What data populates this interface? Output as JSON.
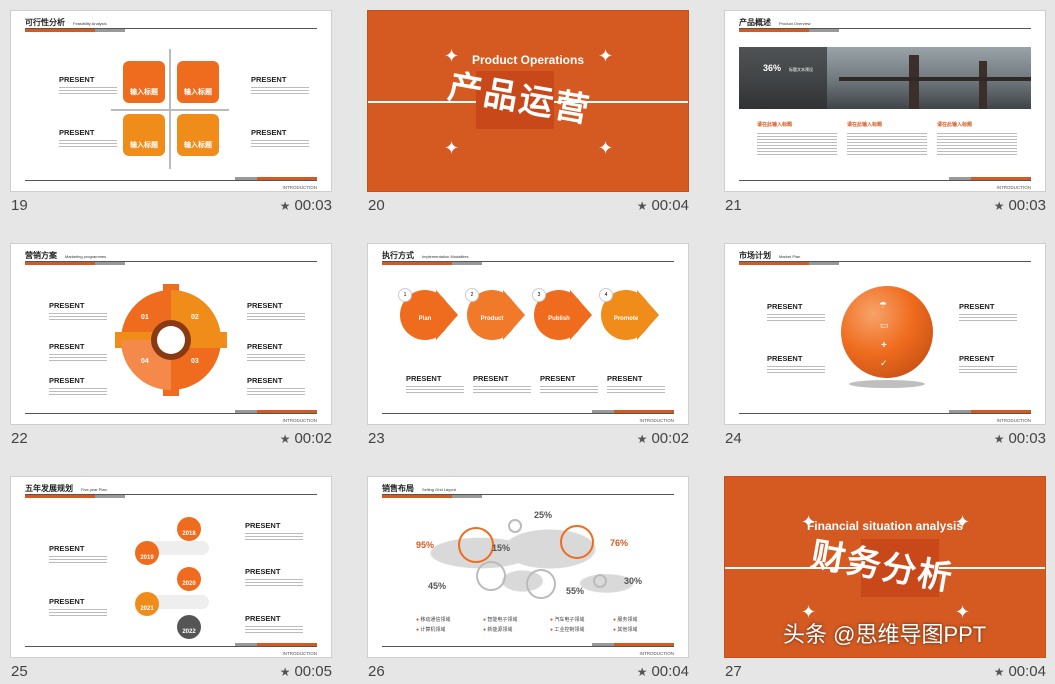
{
  "watermark": "头条 @思维导图PPT",
  "colors": {
    "accent": "#d45a22",
    "orange": "#ef6c1e",
    "gray": "#999999",
    "background": "#e6e6e6"
  },
  "slides": [
    {
      "num": "19",
      "duration": "00:03",
      "title": "可行性分析",
      "subtitle": "Feasibility Analysis",
      "footer": "INTRODUCTION",
      "present": [
        "PRESENT",
        "PRESENT",
        "PRESENT",
        "PRESENT"
      ],
      "box_label": "输入标题"
    },
    {
      "num": "20",
      "duration": "00:04",
      "en_title": "Product Operations",
      "cn_title": "产品运营"
    },
    {
      "num": "21",
      "duration": "00:03",
      "title": "产品概述",
      "subtitle": "Product Overview",
      "footer": "INTRODUCTION",
      "percent": "36%",
      "percent_label": "标题文本预设",
      "col_title": "请在此输入标题"
    },
    {
      "num": "22",
      "duration": "00:02",
      "title": "营销方案",
      "subtitle": "Marketing programmes",
      "footer": "INTRODUCTION",
      "present": [
        "PRESENT",
        "PRESENT",
        "PRESENT",
        "PRESENT",
        "PRESENT",
        "PRESENT"
      ],
      "gear": [
        "01",
        "02",
        "03",
        "04"
      ]
    },
    {
      "num": "23",
      "duration": "00:02",
      "title": "执行方式",
      "subtitle": "Implementation Modalities",
      "footer": "INTRODUCTION",
      "steps": [
        {
          "n": "1",
          "label": "Plan"
        },
        {
          "n": "2",
          "label": "Product"
        },
        {
          "n": "3",
          "label": "Publish"
        },
        {
          "n": "4",
          "label": "Promote"
        }
      ],
      "present": [
        "PRESENT",
        "PRESENT",
        "PRESENT",
        "PRESENT"
      ]
    },
    {
      "num": "24",
      "duration": "00:03",
      "title": "市场计划",
      "subtitle": "Market Plan",
      "footer": "INTRODUCTION",
      "present": [
        "PRESENT",
        "PRESENT",
        "PRESENT",
        "PRESENT"
      ]
    },
    {
      "num": "25",
      "duration": "00:05",
      "title": "五年发展规划",
      "subtitle": "Five-year Plan",
      "footer": "INTRODUCTION",
      "present": [
        "PRESENT",
        "PRESENT",
        "PRESENT",
        "PRESENT",
        "PRESENT"
      ],
      "years": [
        "2018",
        "2019",
        "2020",
        "2021",
        "2022"
      ]
    },
    {
      "num": "26",
      "duration": "00:04",
      "title": "销售布局",
      "subtitle": "Selling Grid Layout",
      "footer": "INTRODUCTION",
      "percents": [
        "25%",
        "95%",
        "15%",
        "76%",
        "45%",
        "55%",
        "30%"
      ],
      "legend": [
        "移动通信领域",
        "计算机领域",
        "智能电子领域",
        "新能源领域",
        "汽车电子领域",
        "工业控制领域",
        "服务领域",
        "其他领域"
      ]
    },
    {
      "num": "27",
      "duration": "00:04",
      "en_title": "Financial situation analysis",
      "cn_title": "财务分析"
    }
  ]
}
